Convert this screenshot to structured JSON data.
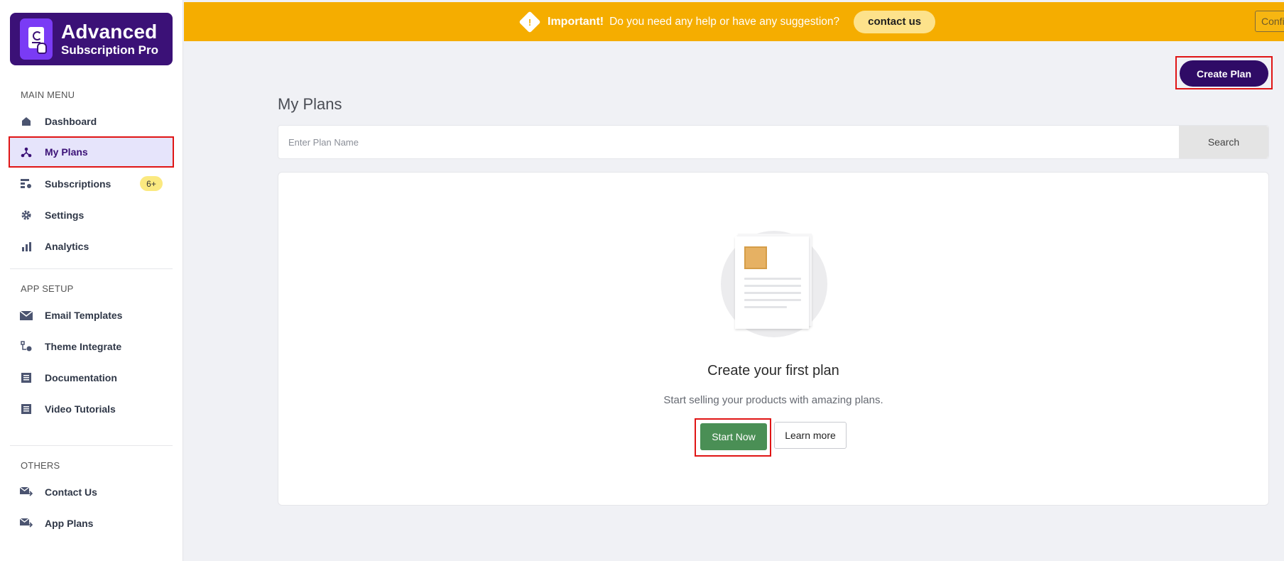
{
  "app": {
    "logo_title": "Advanced",
    "logo_subtitle": "Subscription Pro",
    "brand_color": "#3b1177",
    "banner_color": "#f5ad00"
  },
  "sidebar": {
    "main_menu_title": "MAIN MENU",
    "main_items": [
      {
        "label": "Dashboard",
        "icon": "home-icon"
      },
      {
        "label": "My Plans",
        "icon": "network-icon",
        "active": true
      },
      {
        "label": "Subscriptions",
        "icon": "subscriptions-icon",
        "badge": "6+"
      },
      {
        "label": "Settings",
        "icon": "gear-icon"
      },
      {
        "label": "Analytics",
        "icon": "bar-chart-icon"
      }
    ],
    "app_setup_title": "APP SETUP",
    "setup_items": [
      {
        "label": "Email Templates",
        "icon": "envelope-icon"
      },
      {
        "label": "Theme Integrate",
        "icon": "theme-icon"
      },
      {
        "label": "Documentation",
        "icon": "document-icon"
      },
      {
        "label": "Video Tutorials",
        "icon": "video-icon"
      }
    ],
    "others_title": "OTHERS",
    "other_items": [
      {
        "label": "Contact Us",
        "icon": "mail-send-icon"
      },
      {
        "label": "App Plans",
        "icon": "mail-send-icon"
      }
    ]
  },
  "banner": {
    "strong": "Important!",
    "text": "Do you need any help or have any suggestion?",
    "contact_label": "contact us",
    "config_label": "Confi"
  },
  "main": {
    "create_plan_label": "Create Plan",
    "title": "My Plans",
    "search_placeholder": "Enter Plan Name",
    "search_label": "Search",
    "empty_title": "Create your first plan",
    "empty_subtitle": "Start selling your products with amazing plans.",
    "start_label": "Start Now",
    "learn_label": "Learn more"
  }
}
